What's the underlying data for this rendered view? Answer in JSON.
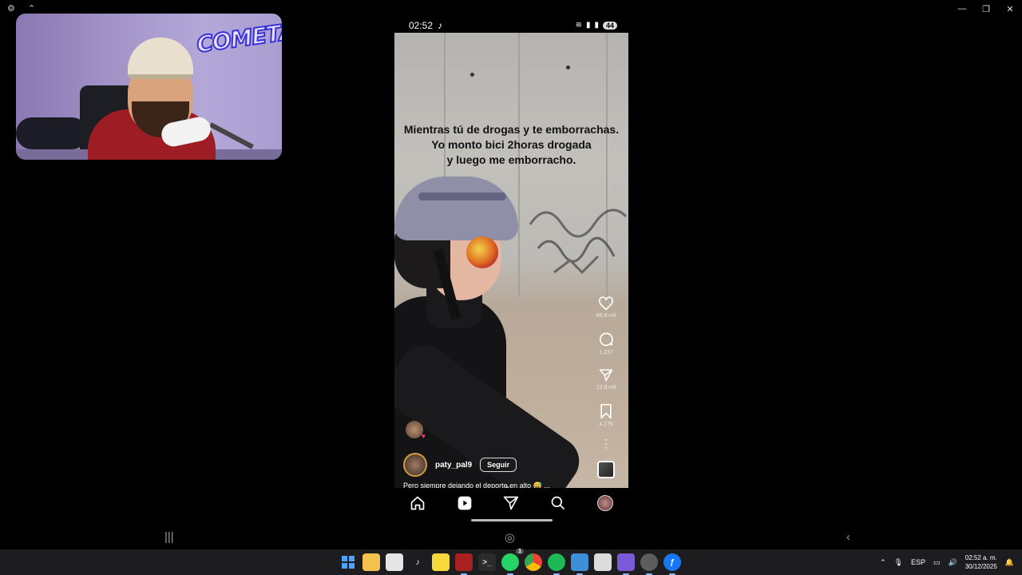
{
  "window": {
    "left_icons": [
      "gear-icon",
      "pin-icon"
    ],
    "controls": [
      "minimize-icon",
      "maximize-icon",
      "close-icon"
    ]
  },
  "webcam": {
    "logo_text": "COMETA"
  },
  "phone": {
    "status": {
      "time": "02:52",
      "battery": "44"
    },
    "caption": [
      "Mientras tú de drogas y te emborrachas.",
      "Yo monto bici 2horas drogada",
      "y luego me emborracho."
    ],
    "actions": {
      "likes": "86.8 mil",
      "comments": "1,237",
      "shares": "23.8 mil",
      "saves": "4,175"
    },
    "post": {
      "username": "paty_pal9",
      "follow_label": "Seguir",
      "description": "Pero siempre dejando el deporte en alto 😅 ..."
    },
    "nav": [
      "home-icon",
      "reels-icon",
      "send-icon",
      "search-icon",
      "profile-avatar"
    ]
  },
  "taskbar": {
    "apps": [
      "start",
      "file-explorer",
      "store",
      "tiktok",
      "sticky-notes",
      "voicemeeter",
      "terminal",
      "whatsapp",
      "chrome",
      "spotify",
      "app-window",
      "app-window-2",
      "app-3",
      "app-4",
      "emulator"
    ],
    "whatsapp_badge": "1",
    "language": "ESP",
    "time": "02:52 a. m.",
    "date": "30/12/2025"
  },
  "colors": {
    "accent": "#8ab4f8",
    "like_heart": "#ff2e63",
    "taskbar_bg": "#1d1d1f"
  }
}
